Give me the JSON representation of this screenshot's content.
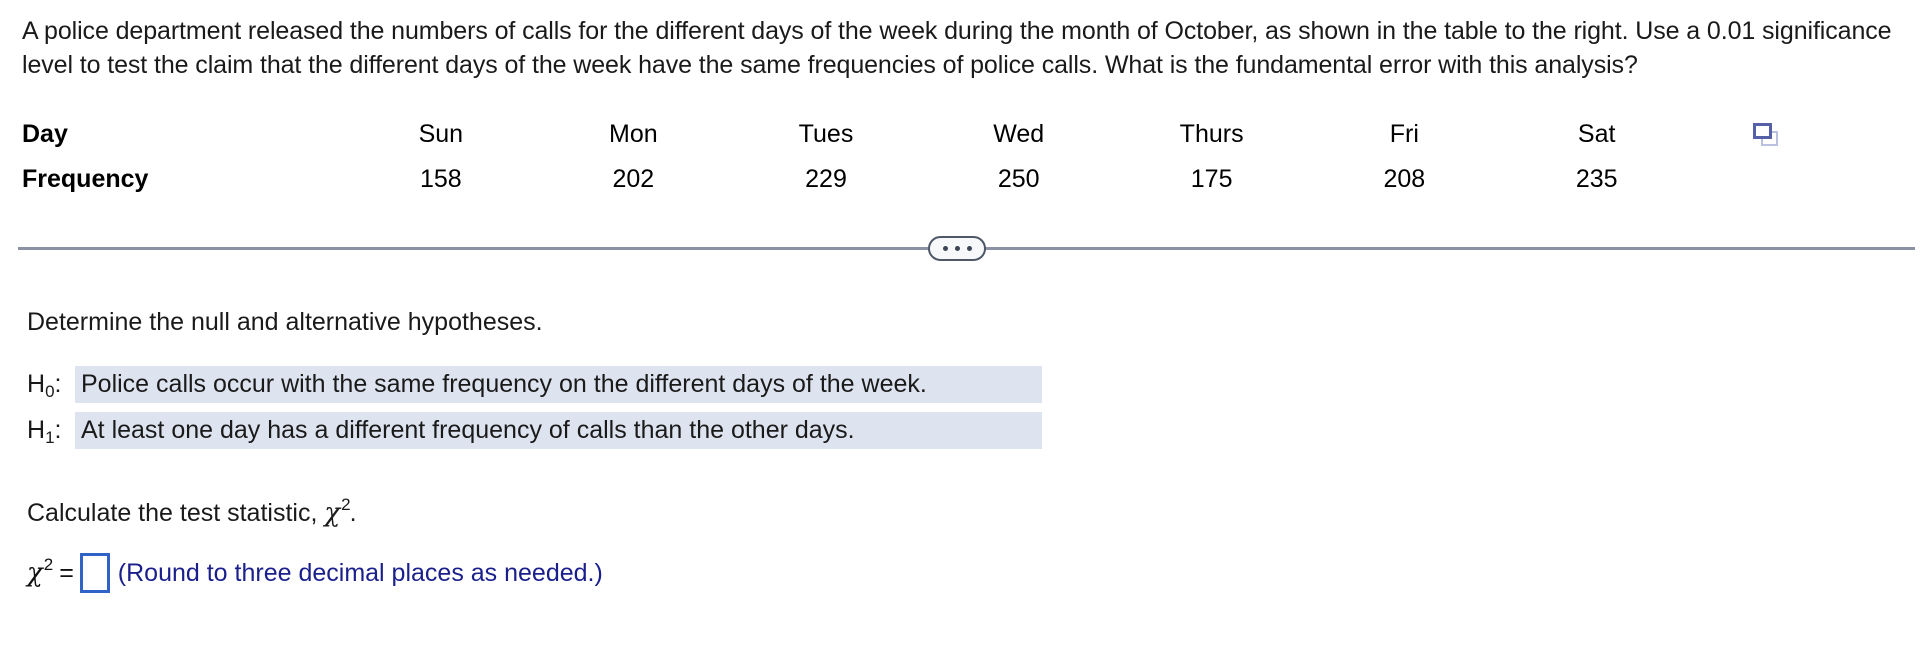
{
  "problem": {
    "statement": "A police department released the numbers of calls for the different days of the week during the month of October, as shown in the table to the right. Use a 0.01 significance level to test the claim that the different days of the week have the same frequencies of police calls. What is the fundamental error with this analysis?"
  },
  "table": {
    "row_labels": [
      "Day",
      "Frequency"
    ],
    "days": [
      "Sun",
      "Mon",
      "Tues",
      "Wed",
      "Thurs",
      "Fri",
      "Sat"
    ],
    "frequencies": [
      "158",
      "202",
      "229",
      "250",
      "175",
      "208",
      "235"
    ],
    "copy_icon_name": "copy-data-icon"
  },
  "divider": {
    "ellipsis_label": "•••",
    "line_color": "#8b92a3"
  },
  "answer_section": {
    "determine_prompt": "Determine the null and alternative hypotheses.",
    "hypotheses": [
      {
        "label_base": "H",
        "label_sub": "0",
        "label_colon": ":",
        "text": "Police calls occur with the same frequency on the different days of the week."
      },
      {
        "label_base": "H",
        "label_sub": "1",
        "label_colon": ":",
        "text": "At least one day has a different frequency of calls than the other days."
      }
    ],
    "calculate_prompt_prefix": "Calculate the test statistic, ",
    "calculate_prompt_chi": "χ",
    "calculate_prompt_exp": "2",
    "calculate_prompt_suffix": ".",
    "answer_chi": "χ",
    "answer_exp": "2",
    "answer_equals": "=",
    "input_value": "",
    "input_placeholder": "",
    "rounding_note": "(Round to three decimal places as needed.)",
    "highlight_color": "#dee4ef",
    "input_border_color": "#2f63c8",
    "note_color": "#1a1f8c"
  },
  "chart_data": {
    "type": "table",
    "title": "Numbers of police calls by day of week (October)",
    "categories": [
      "Sun",
      "Mon",
      "Tues",
      "Wed",
      "Thurs",
      "Fri",
      "Sat"
    ],
    "values": [
      158,
      202,
      229,
      250,
      175,
      208,
      235
    ],
    "xlabel": "Day",
    "ylabel": "Frequency"
  }
}
